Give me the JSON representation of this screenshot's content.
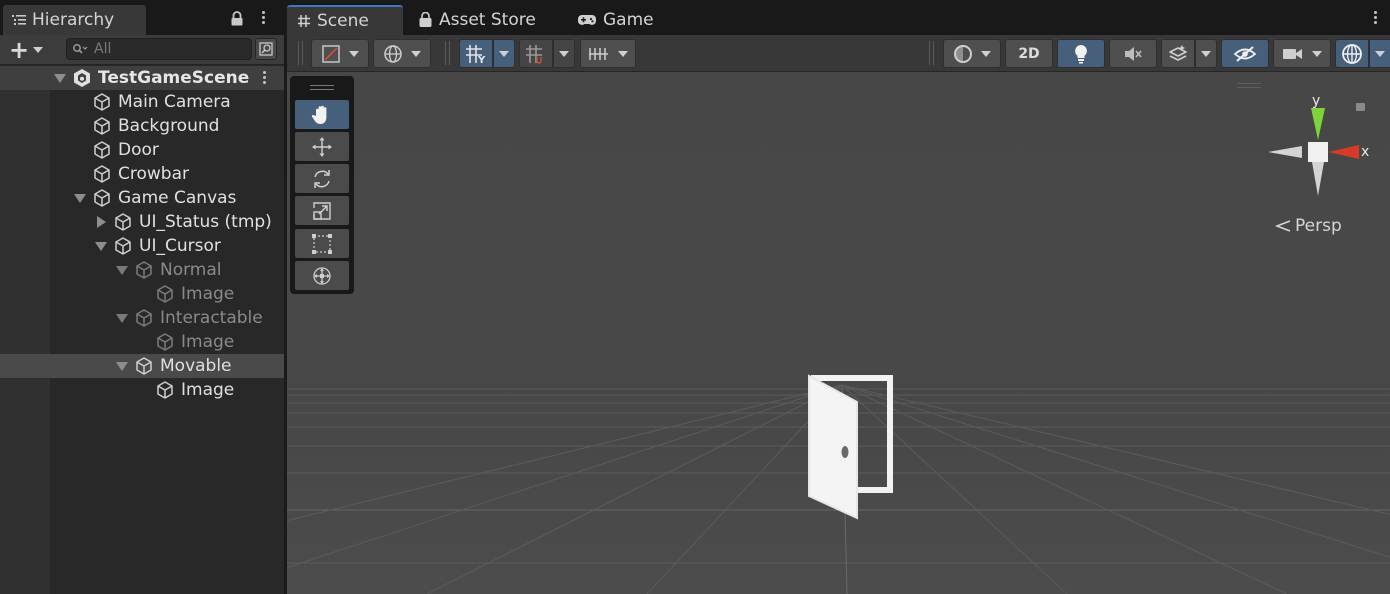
{
  "hierarchy": {
    "tab_label": "Hierarchy",
    "search_placeholder": "All",
    "scene_name": "TestGameScene",
    "rows": [
      {
        "label": "Main Camera"
      },
      {
        "label": "Background"
      },
      {
        "label": "Door"
      },
      {
        "label": "Crowbar"
      },
      {
        "label": "Game Canvas"
      },
      {
        "label": "UI_Status (tmp)"
      },
      {
        "label": "UI_Cursor"
      },
      {
        "label": "Normal"
      },
      {
        "label": "Image"
      },
      {
        "label": "Interactable"
      },
      {
        "label": "Image"
      },
      {
        "label": "Movable"
      },
      {
        "label": "Image"
      }
    ]
  },
  "scene_panel": {
    "tabs": [
      {
        "label": "Scene",
        "icon": "hash-icon",
        "active": true
      },
      {
        "label": "Asset Store",
        "icon": "store-bag-icon",
        "active": false
      },
      {
        "label": "Game",
        "icon": "gamepad-icon",
        "active": false
      }
    ],
    "toolbar": {
      "mode_2d_label": "2D"
    },
    "tools": [
      "hand-tool",
      "move-tool",
      "rotate-tool",
      "scale-tool",
      "rect-tool",
      "transform-tool"
    ],
    "gizmo": {
      "x_label": "x",
      "y_label": "y",
      "projection_label": "Persp"
    }
  },
  "colors": {
    "accent_active": "#46607c",
    "tab_highlight": "#3a79bb",
    "gizmo_x": "#d83a2a",
    "gizmo_y": "#7ed23a"
  }
}
